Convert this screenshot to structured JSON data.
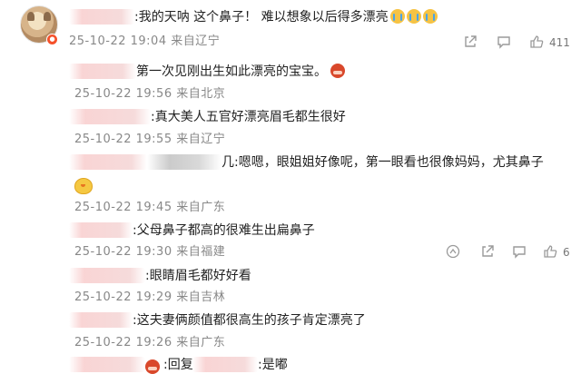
{
  "post": {
    "username_suffix": ":",
    "text": "我的天呐  这个鼻子！ 难以想象以后得多漂亮",
    "meta": "25-10-22 19:04 来自辽宁",
    "likes": "411",
    "icons": [
      "share-icon",
      "comment-icon",
      "like-icon"
    ]
  },
  "replies": [
    {
      "prefix": "",
      "text": "第一次见刚出生如此漂亮的宝宝。",
      "meta": "25-10-22 19:56 来自北京"
    },
    {
      "prefix": ":",
      "text": "真大美人五官好漂亮眉毛都生很好",
      "meta": "25-10-22 19:55 来自辽宁"
    },
    {
      "prefix": "几:",
      "text": "嗯嗯，眼姐姐好像呢，第一眼看也很像妈妈，尤其鼻子",
      "meta": "25-10-22 19:45 来自广东"
    },
    {
      "prefix": ":",
      "text": "父母鼻子都高的很难生出扁鼻子",
      "meta": "25-10-22 19:30 来自福建",
      "likes": "6"
    },
    {
      "prefix": ":",
      "text": "眼睛眉毛都好好看",
      "meta": "25-10-22 19:29 来自吉林"
    },
    {
      "prefix": ":",
      "text": "这夫妻俩颜值都很高生的孩子肯定漂亮了",
      "meta": "25-10-22 19:26 来自广东"
    },
    {
      "prefix": ":回复",
      "text": ":是嘟",
      "meta": ""
    }
  ],
  "colors": {
    "meta": "#888888",
    "text": "#222222",
    "icon": "#9a9a9a",
    "badge": "#f5512b"
  }
}
